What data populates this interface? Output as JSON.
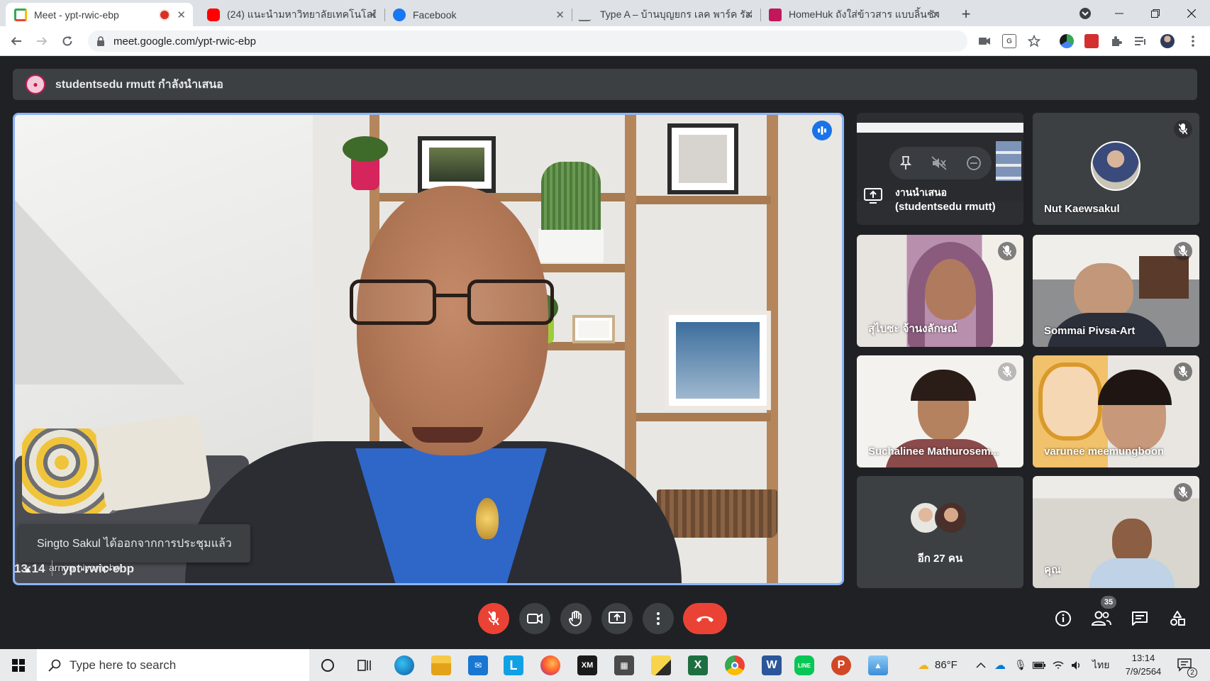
{
  "browser": {
    "tabs": [
      {
        "title": "Meet - ypt-rwic-ebp",
        "active": true,
        "favicon_color": "#34a853"
      },
      {
        "title": "(24) แนะนำมหาวิทยาลัยเทคโนโลยีราชม",
        "active": false,
        "favicon_color": "#ff0000"
      },
      {
        "title": "Facebook",
        "active": false,
        "favicon_color": "#1877f2"
      },
      {
        "title": "Type A – บ้านบุญยกร เลค พาร์ค รังสิ",
        "active": false,
        "favicon_color": "#6d6d6d"
      },
      {
        "title": "HomeHuk ถังใส่ข้าวสาร แบบลิ้นชัก 1",
        "active": false,
        "favicon_color": "#c2185b"
      }
    ],
    "close_glyph": "✕",
    "new_tab_glyph": "+",
    "url": "meet.google.com/ypt-rwic-ebp"
  },
  "meet": {
    "presenter_banner": "studentsedu rmutt กำลังนำเสนอ",
    "main_speaker": {
      "name": "arnon niyomphol"
    },
    "toast": "Singto Sakul ได้ออกจากการประชุมแล้ว",
    "presenting_tile": {
      "line1": "งานนำเสนอ",
      "line2": "(studentsedu rmutt)"
    },
    "participants": [
      {
        "name": "Nut Kaewsakul",
        "muted": true
      },
      {
        "name": "สุไบซะ จ้านงลักษณ์",
        "muted": true
      },
      {
        "name": "Sommai Pivsa-Art",
        "muted": true
      },
      {
        "name": "Suchalinee Mathurosem...",
        "muted": true
      },
      {
        "name": "varunee meemungboon",
        "muted": true
      },
      {
        "name": "อีก 27 คน",
        "muted": false
      },
      {
        "name": "คุณ",
        "muted": true
      }
    ],
    "time": "13:14",
    "meeting_code": "ypt-rwic-ebp",
    "participant_count": "35"
  },
  "taskbar": {
    "search_placeholder": "Type here to search",
    "weather": "86°F",
    "language": "ไทย",
    "time": "13:14",
    "date": "7/9/2564",
    "notification_count": "2",
    "apps": [
      {
        "name": "cortana",
        "color": "#2b2b2b"
      },
      {
        "name": "task-view",
        "color": "#2b2b2b"
      },
      {
        "name": "edge",
        "color": "#0c7cd5"
      },
      {
        "name": "file-explorer",
        "color": "#f2b400"
      },
      {
        "name": "mail",
        "color": "#1976d2"
      },
      {
        "name": "app-l",
        "color": "#0fa0e6",
        "label": "L"
      },
      {
        "name": "firefox",
        "color": "#ff7139"
      },
      {
        "name": "xm",
        "color": "#1a1a1a",
        "label": "XM"
      },
      {
        "name": "calculator",
        "color": "#4a4a4a"
      },
      {
        "name": "sticky-notes",
        "color": "#f7d44c"
      },
      {
        "name": "excel",
        "color": "#1d6f42",
        "label": "X"
      },
      {
        "name": "chrome",
        "color": "#4285f4"
      },
      {
        "name": "word",
        "color": "#2b579a",
        "label": "W"
      },
      {
        "name": "line",
        "color": "#06c755",
        "label": "LINE"
      },
      {
        "name": "powerpoint",
        "color": "#d24726",
        "label": "P"
      },
      {
        "name": "photos",
        "color": "#3b8ed8"
      }
    ]
  }
}
